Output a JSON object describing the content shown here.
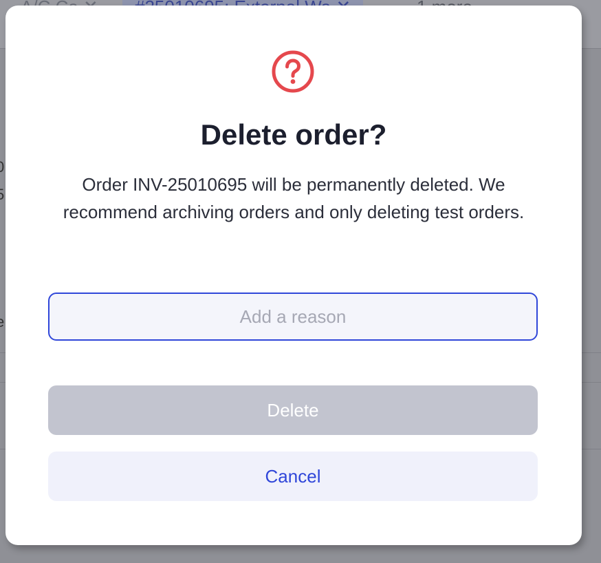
{
  "background": {
    "tabs": [
      "A/C Ca",
      "#25010695: External Wa",
      "1 more"
    ],
    "fragments": [
      "0",
      "5",
      "e"
    ]
  },
  "dialog": {
    "icon": "question-circle-icon",
    "icon_color": "#e5484d",
    "title": "Delete order?",
    "message": "Order INV-25010695 will be permanently deleted. We recommend archiving orders and only deleting test orders.",
    "reason_placeholder": "Add a reason",
    "reason_value": "",
    "delete_label": "Delete",
    "cancel_label": "Cancel",
    "accent_color": "#2f46d9",
    "delete_disabled": true
  }
}
